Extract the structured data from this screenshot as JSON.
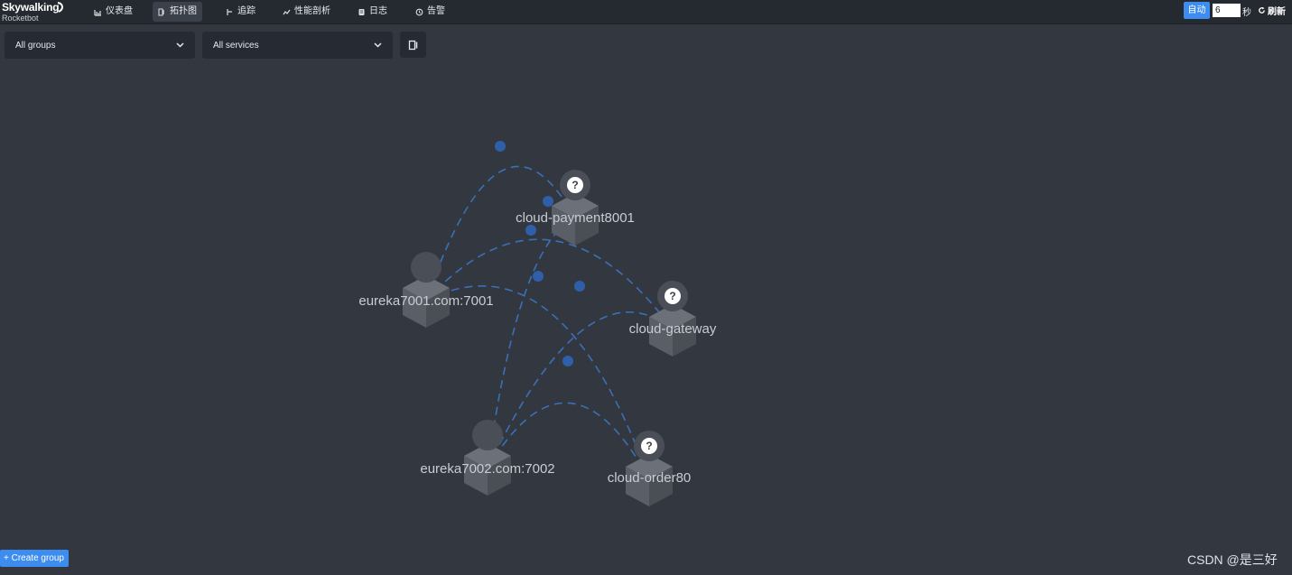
{
  "app": {
    "logo_main": "Skywalking",
    "logo_sub": "Rocketbot"
  },
  "nav": {
    "items": [
      {
        "label": "仪表盘",
        "icon": "dashboard-icon"
      },
      {
        "label": "拓扑图",
        "icon": "topology-icon",
        "active": true
      },
      {
        "label": "追踪",
        "icon": "trace-icon"
      },
      {
        "label": "性能剖析",
        "icon": "profile-icon"
      },
      {
        "label": "日志",
        "icon": "log-icon"
      },
      {
        "label": "告警",
        "icon": "alarm-icon"
      }
    ]
  },
  "refresh": {
    "auto_label": "自动",
    "interval_value": "6",
    "seconds_label": "秒",
    "refresh_label": "刷新"
  },
  "toolbar": {
    "group_select": "All groups",
    "service_select": "All services"
  },
  "topology": {
    "nodes": [
      {
        "id": "payment",
        "label": "cloud-payment8001",
        "unknown": true
      },
      {
        "id": "eureka7001",
        "label": "eureka7001.com:7001",
        "unknown": false
      },
      {
        "id": "gateway",
        "label": "cloud-gateway",
        "unknown": true
      },
      {
        "id": "eureka7002",
        "label": "eureka7002.com:7002",
        "unknown": false
      },
      {
        "id": "order",
        "label": "cloud-order80",
        "unknown": true
      }
    ],
    "links": [
      {
        "source": "eureka7001",
        "target": "payment"
      },
      {
        "source": "eureka7001",
        "target": "gateway"
      },
      {
        "source": "eureka7001",
        "target": "order"
      },
      {
        "source": "eureka7002",
        "target": "payment"
      },
      {
        "source": "eureka7002",
        "target": "gateway"
      },
      {
        "source": "eureka7002",
        "target": "order"
      }
    ],
    "colors": {
      "link": "#3b6fb6",
      "link_dot": "#2f5fa8",
      "cube_top": "#6c7078",
      "cube_left": "#5a5e66",
      "cube_right": "#4a4e55"
    }
  },
  "footer": {
    "create_group": "+ Create group",
    "watermark": "CSDN @是三好"
  }
}
